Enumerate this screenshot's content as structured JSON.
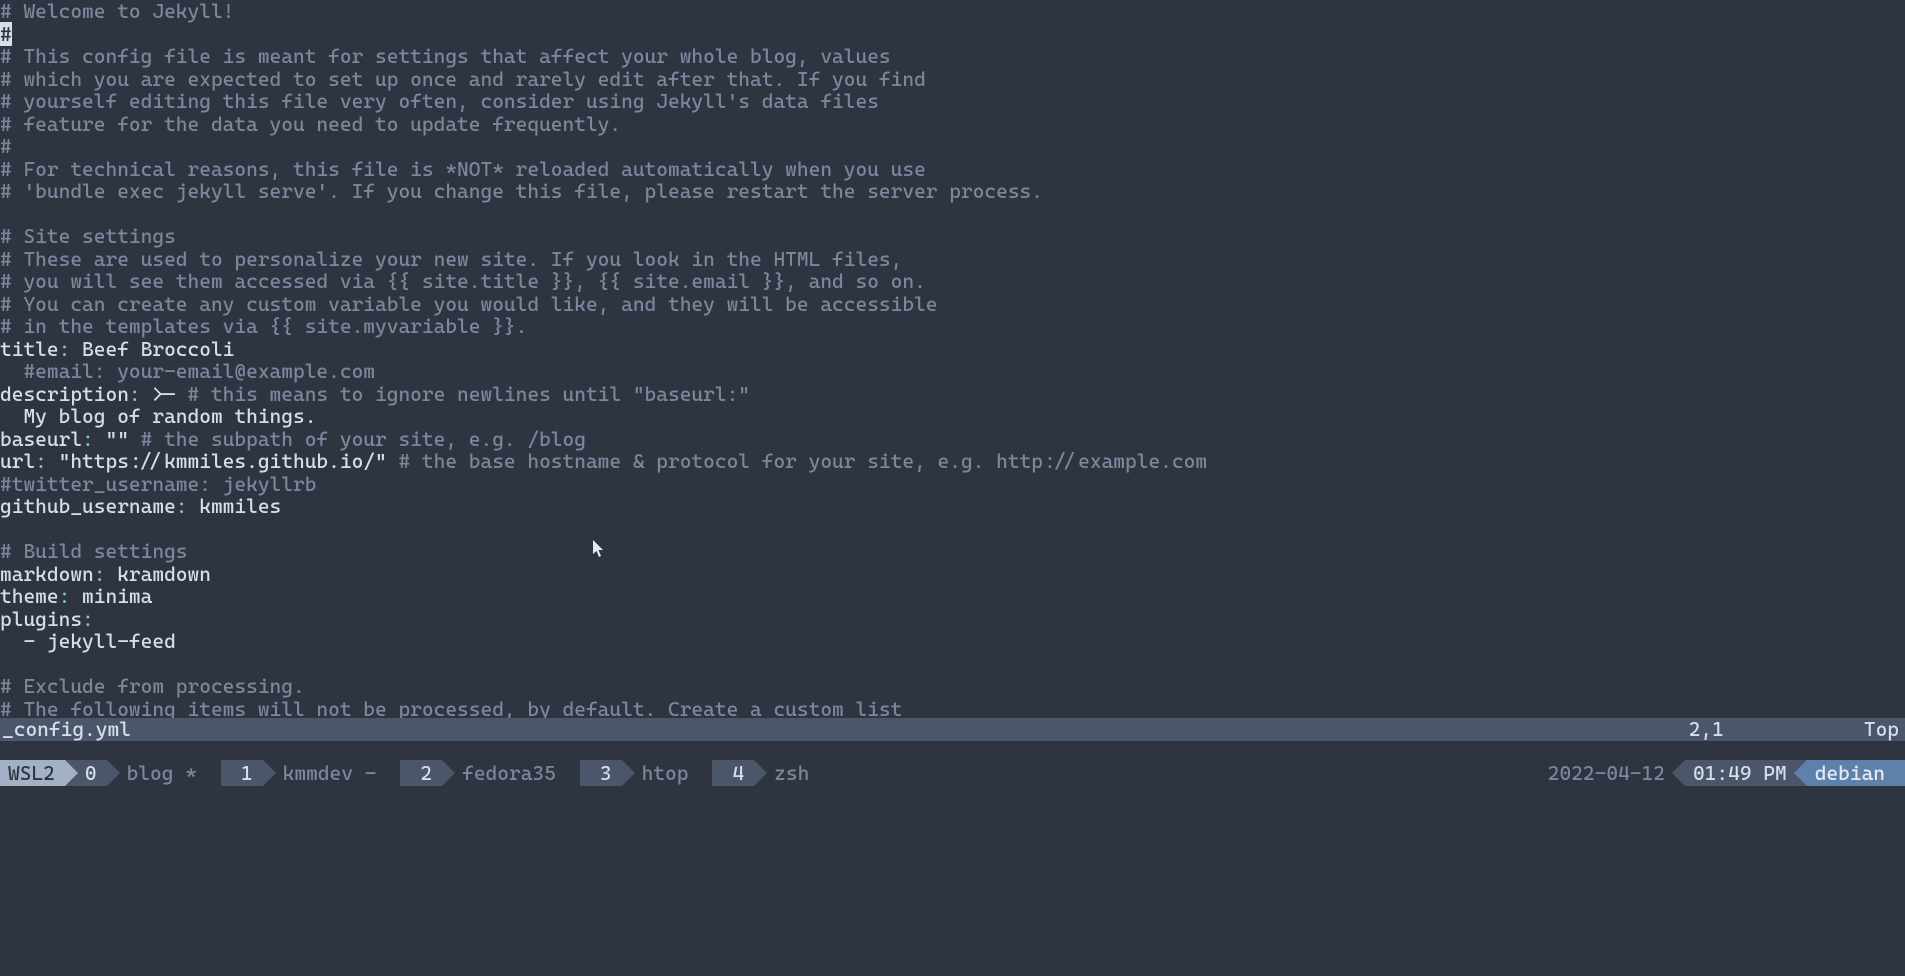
{
  "editor": {
    "lines": [
      {
        "segs": [
          {
            "t": "# Welcome to Jekyll!",
            "cls": "comment"
          }
        ]
      },
      {
        "segs": [
          {
            "t": "#",
            "cls": "comment cursor-cell"
          }
        ]
      },
      {
        "segs": [
          {
            "t": "# This config file is meant for settings that affect your whole blog, values",
            "cls": "comment"
          }
        ]
      },
      {
        "segs": [
          {
            "t": "# which you are expected to set up once and rarely edit after that. If you find",
            "cls": "comment"
          }
        ]
      },
      {
        "segs": [
          {
            "t": "# yourself editing this file very often, consider using Jekyll's data files",
            "cls": "comment"
          }
        ]
      },
      {
        "segs": [
          {
            "t": "# feature for the data you need to update frequently.",
            "cls": "comment"
          }
        ]
      },
      {
        "segs": [
          {
            "t": "#",
            "cls": "comment"
          }
        ]
      },
      {
        "segs": [
          {
            "t": "# For technical reasons, this file is *NOT* reloaded automatically when you use",
            "cls": "comment"
          }
        ]
      },
      {
        "segs": [
          {
            "t": "# 'bundle exec jekyll serve'. If you change this file, please restart the server process.",
            "cls": "comment"
          }
        ]
      },
      {
        "segs": []
      },
      {
        "segs": [
          {
            "t": "# Site settings",
            "cls": "comment"
          }
        ]
      },
      {
        "segs": [
          {
            "t": "# These are used to personalize your new site. If you look in the HTML files,",
            "cls": "comment"
          }
        ]
      },
      {
        "segs": [
          {
            "t": "# you will see them accessed via {{ site.title }}, {{ site.email }}, and so on.",
            "cls": "comment"
          }
        ]
      },
      {
        "segs": [
          {
            "t": "# You can create any custom variable you would like, and they will be accessible",
            "cls": "comment"
          }
        ]
      },
      {
        "segs": [
          {
            "t": "# in the templates via {{ site.myvariable }}.",
            "cls": "comment"
          }
        ]
      },
      {
        "segs": [
          {
            "t": "title",
            "cls": "key"
          },
          {
            "t": ":",
            "cls": "punct"
          },
          {
            "t": " Beef Broccoli",
            "cls": "string"
          }
        ]
      },
      {
        "segs": [
          {
            "t": "  #email: your-email@example.com",
            "cls": "comment"
          }
        ]
      },
      {
        "segs": [
          {
            "t": "description",
            "cls": "key"
          },
          {
            "t": ":",
            "cls": "punct"
          },
          {
            "t": " >- ",
            "cls": "string"
          },
          {
            "t": "# this means to ignore newlines until \"baseurl:\"",
            "cls": "comment"
          }
        ]
      },
      {
        "segs": [
          {
            "t": "  My blog of random things.",
            "cls": "string"
          }
        ]
      },
      {
        "segs": [
          {
            "t": "baseurl",
            "cls": "key"
          },
          {
            "t": ":",
            "cls": "punct"
          },
          {
            "t": " \"\" ",
            "cls": "string"
          },
          {
            "t": "# the subpath of your site, e.g. /blog",
            "cls": "comment"
          }
        ]
      },
      {
        "segs": [
          {
            "t": "url",
            "cls": "key"
          },
          {
            "t": ":",
            "cls": "punct"
          },
          {
            "t": " \"https://kmmiles.github.io/\" ",
            "cls": "string"
          },
          {
            "t": "# the base hostname & protocol for your site, e.g. http://example.com",
            "cls": "comment"
          }
        ]
      },
      {
        "segs": [
          {
            "t": "#twitter_username: jekyllrb",
            "cls": "comment"
          }
        ]
      },
      {
        "segs": [
          {
            "t": "github_username",
            "cls": "key"
          },
          {
            "t": ":",
            "cls": "punct"
          },
          {
            "t": " kmmiles",
            "cls": "string"
          }
        ]
      },
      {
        "segs": []
      },
      {
        "segs": [
          {
            "t": "# Build settings",
            "cls": "comment"
          }
        ]
      },
      {
        "segs": [
          {
            "t": "markdown",
            "cls": "key"
          },
          {
            "t": ":",
            "cls": "punct"
          },
          {
            "t": " kramdown",
            "cls": "string"
          }
        ]
      },
      {
        "segs": [
          {
            "t": "theme",
            "cls": "key"
          },
          {
            "t": ":",
            "cls": "punct"
          },
          {
            "t": " minima",
            "cls": "string"
          }
        ]
      },
      {
        "segs": [
          {
            "t": "plugins",
            "cls": "key"
          },
          {
            "t": ":",
            "cls": "punct"
          }
        ]
      },
      {
        "segs": [
          {
            "t": "  - ",
            "cls": "dash"
          },
          {
            "t": "jekyll-feed",
            "cls": "string"
          }
        ]
      },
      {
        "segs": []
      },
      {
        "segs": [
          {
            "t": "# Exclude from processing.",
            "cls": "comment"
          }
        ]
      },
      {
        "segs": [
          {
            "t": "# The following items will not be processed, by default. Create a custom list",
            "cls": "comment"
          }
        ]
      }
    ]
  },
  "status": {
    "filename": "_config.yml",
    "position": "2,1",
    "scroll": "Top"
  },
  "tmux": {
    "session_host": "WSL2",
    "session_left_num": "0",
    "session_left_name": "blog *",
    "windows": [
      {
        "num": "1",
        "name": "kmmdev -"
      },
      {
        "num": "2",
        "name": "fedora35"
      },
      {
        "num": "3",
        "name": "htop"
      },
      {
        "num": "4",
        "name": "zsh"
      }
    ],
    "date": "2022-04-12",
    "time": "01:49 PM",
    "host_right": "debian"
  }
}
